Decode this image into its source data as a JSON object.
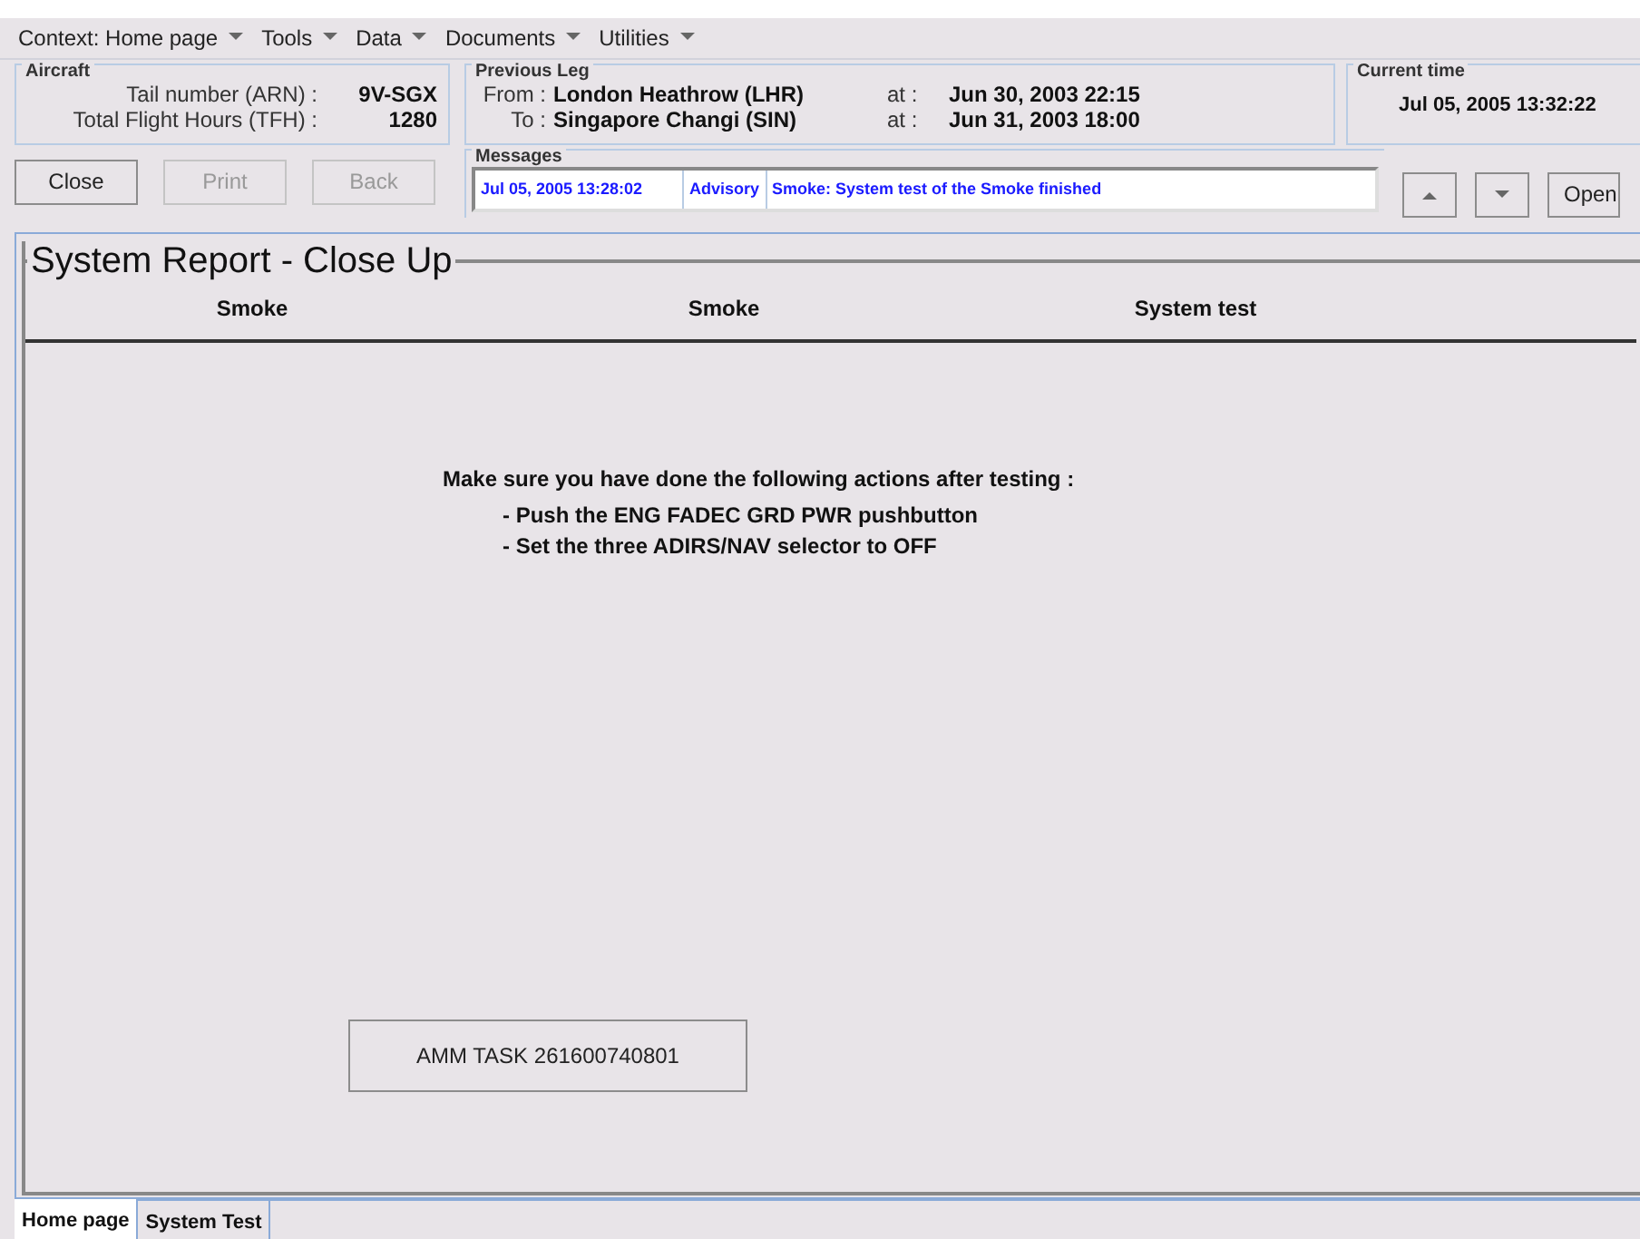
{
  "menu": [
    {
      "label": "Context: Home page"
    },
    {
      "label": "Tools"
    },
    {
      "label": "Data"
    },
    {
      "label": "Documents"
    },
    {
      "label": "Utilities"
    }
  ],
  "aircraft": {
    "title": "Aircraft",
    "rows": [
      {
        "label": "Tail number (ARN) :",
        "value": "9V-SGX"
      },
      {
        "label": "Total Flight Hours (TFH) :",
        "value": "1280"
      }
    ]
  },
  "previous_leg": {
    "title": "Previous Leg",
    "rows": [
      {
        "label": "From :",
        "place": "London Heathrow (LHR)",
        "at": "at :",
        "time": "Jun 30, 2003 22:15"
      },
      {
        "label": "To :",
        "place": "Singapore Changi (SIN)",
        "at": "at :",
        "time": "Jun 31, 2003 18:00"
      }
    ]
  },
  "current_time": {
    "title": "Current time",
    "value": "Jul 05, 2005 13:32:22"
  },
  "buttons": [
    {
      "label": "Close",
      "disabled": false
    },
    {
      "label": "Print",
      "disabled": true
    },
    {
      "label": "Back",
      "disabled": true
    }
  ],
  "messages": {
    "title": "Messages",
    "date": "Jul 05, 2005 13:28:02",
    "level": "Advisory",
    "text": "Smoke: System test of the Smoke finished",
    "open": "Open"
  },
  "report": {
    "title": "System Report - Close Up",
    "columns": [
      "Smoke",
      "Smoke",
      "System test"
    ],
    "heading": "Make sure you have done the following actions after testing :",
    "actions": [
      "- Push the ENG FADEC GRD PWR pushbutton",
      "- Set the three ADIRS/NAV selector to OFF"
    ],
    "task_button": "AMM TASK 261600740801"
  },
  "tabs": [
    {
      "label": "Home page",
      "selected": true
    },
    {
      "label": "System Test",
      "selected": false
    }
  ]
}
